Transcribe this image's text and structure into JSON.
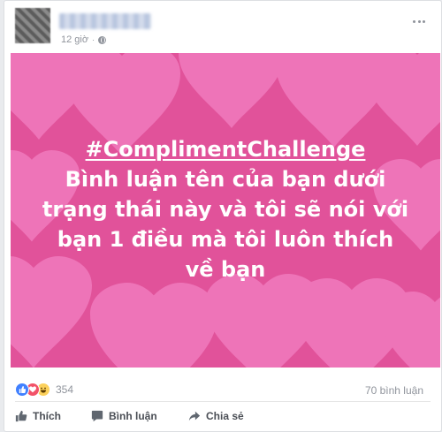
{
  "post": {
    "time": "12 giờ",
    "separator": "·",
    "privacy_icon": "globe-icon",
    "image": {
      "bg_color": "#e1529a",
      "heart_color": "#f07bbd",
      "hashtag": "#ComplimentChallenge",
      "lines": [
        "Bình luận tên của bạn dưới",
        "trạng thái này và tôi sẽ nói với",
        "bạn 1 điều mà tôi luôn thích",
        "về bạn"
      ]
    }
  },
  "stats": {
    "reaction_icons": [
      "like-icon",
      "love-icon",
      "haha-icon"
    ],
    "reaction_count": "354",
    "comment_count": "70 bình luận"
  },
  "actions": {
    "like": "Thích",
    "comment": "Bình luận",
    "share": "Chia sẻ"
  }
}
